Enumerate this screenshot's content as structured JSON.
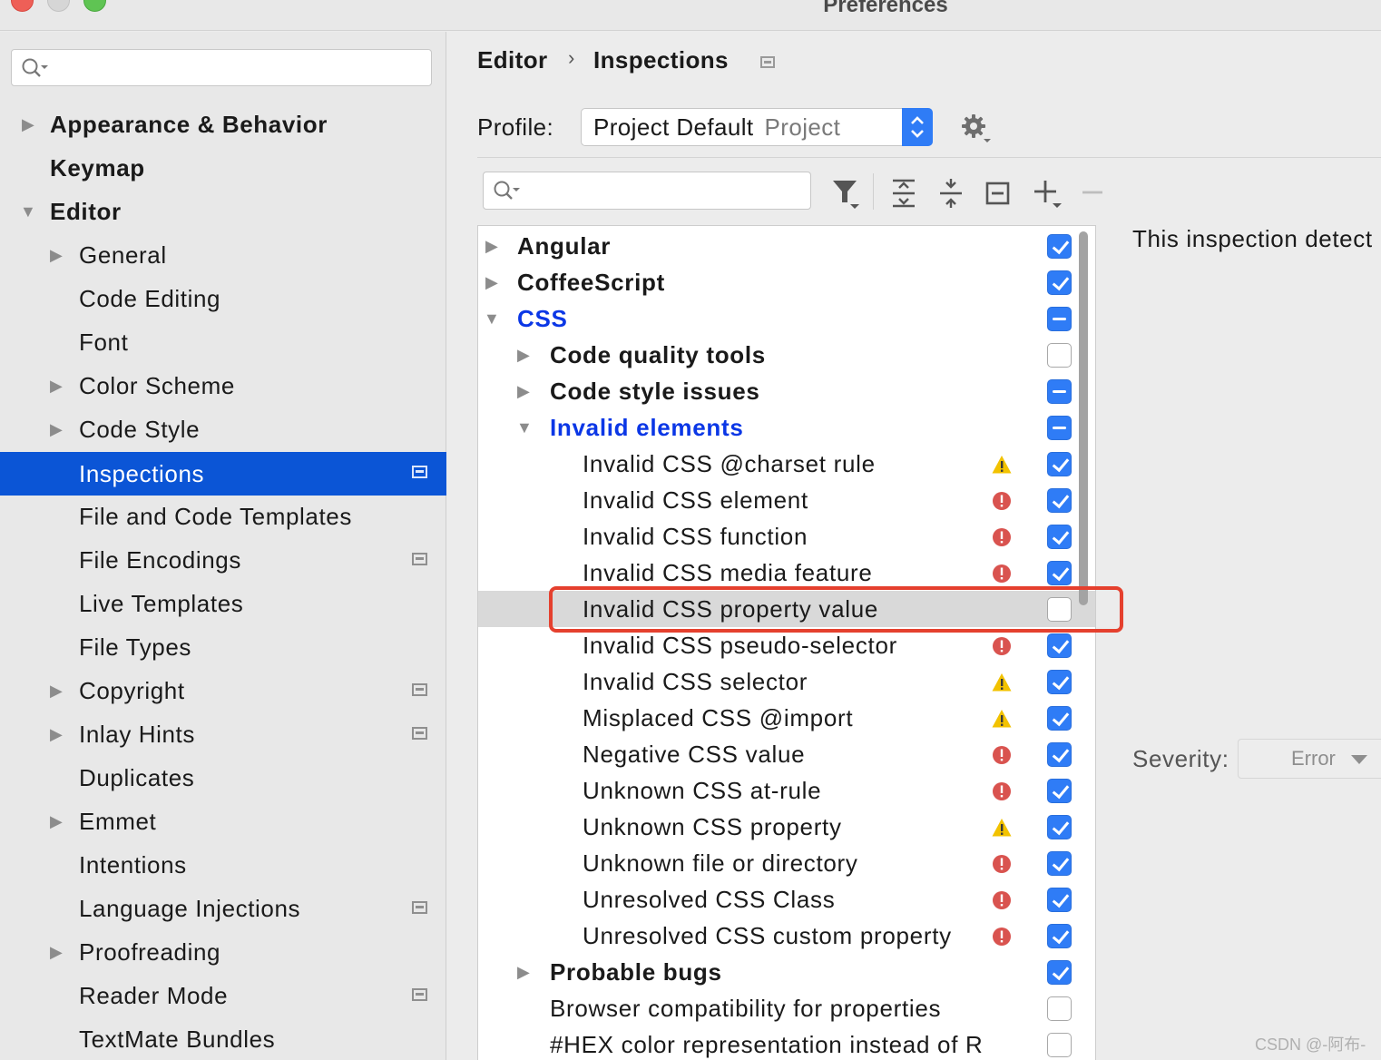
{
  "window": {
    "title": "Preferences"
  },
  "sidebar": {
    "search_placeholder": "",
    "items": [
      {
        "label": "Appearance & Behavior"
      },
      {
        "label": "Keymap"
      },
      {
        "label": "Editor"
      },
      {
        "label": "General"
      },
      {
        "label": "Code Editing"
      },
      {
        "label": "Font"
      },
      {
        "label": "Color Scheme"
      },
      {
        "label": "Code Style"
      },
      {
        "label": "Inspections"
      },
      {
        "label": "File and Code Templates"
      },
      {
        "label": "File Encodings"
      },
      {
        "label": "Live Templates"
      },
      {
        "label": "File Types"
      },
      {
        "label": "Copyright"
      },
      {
        "label": "Inlay Hints"
      },
      {
        "label": "Duplicates"
      },
      {
        "label": "Emmet"
      },
      {
        "label": "Intentions"
      },
      {
        "label": "Language Injections"
      },
      {
        "label": "Proofreading"
      },
      {
        "label": "Reader Mode"
      },
      {
        "label": "TextMate Bundles"
      }
    ]
  },
  "breadcrumb": {
    "parent": "Editor",
    "separator": "›",
    "current": "Inspections"
  },
  "profile": {
    "label": "Profile:",
    "value": "Project Default",
    "scope": "Project"
  },
  "toolbar": {
    "search_placeholder": "",
    "icons": [
      "filter-icon",
      "expand-all-icon",
      "collapse-all-icon",
      "reset-icon",
      "add-icon",
      "remove-icon"
    ]
  },
  "tree": {
    "rows": [
      {
        "label": "Angular",
        "state": "checked"
      },
      {
        "label": "CoffeeScript",
        "state": "checked"
      },
      {
        "label": "CSS",
        "state": "mixed"
      },
      {
        "label": "Code quality tools",
        "state": "unchecked"
      },
      {
        "label": "Code style issues",
        "state": "mixed"
      },
      {
        "label": "Invalid elements",
        "state": "mixed"
      },
      {
        "label": "Invalid CSS @charset rule",
        "severity": "warning",
        "state": "checked"
      },
      {
        "label": "Invalid CSS element",
        "severity": "error",
        "state": "checked"
      },
      {
        "label": "Invalid CSS function",
        "severity": "error",
        "state": "checked"
      },
      {
        "label": "Invalid CSS media feature",
        "severity": "error",
        "state": "checked"
      },
      {
        "label": "Invalid CSS property value",
        "severity": "none",
        "state": "unchecked",
        "selected": true
      },
      {
        "label": "Invalid CSS pseudo-selector",
        "severity": "error",
        "state": "checked"
      },
      {
        "label": "Invalid CSS selector",
        "severity": "warning",
        "state": "checked"
      },
      {
        "label": "Misplaced CSS @import",
        "severity": "warning",
        "state": "checked"
      },
      {
        "label": "Negative CSS value",
        "severity": "error",
        "state": "checked"
      },
      {
        "label": "Unknown CSS at-rule",
        "severity": "error",
        "state": "checked"
      },
      {
        "label": "Unknown CSS property",
        "severity": "warning",
        "state": "checked"
      },
      {
        "label": "Unknown file or directory",
        "severity": "error",
        "state": "checked"
      },
      {
        "label": "Unresolved CSS Class",
        "severity": "error",
        "state": "checked"
      },
      {
        "label": "Unresolved CSS custom property",
        "severity": "error",
        "state": "checked"
      },
      {
        "label": "Probable bugs",
        "state": "checked"
      },
      {
        "label": "Browser compatibility for properties",
        "state": "unchecked"
      },
      {
        "label": "#HEX color representation instead of R",
        "state": "unchecked"
      }
    ]
  },
  "details": {
    "description": "This inspection detect",
    "severity_label": "Severity:",
    "severity_value": "Error"
  },
  "watermark": "CSDN @-阿布-",
  "colors": {
    "accent": "#0b55d6",
    "checkbox": "#2f7cf6",
    "link_blue": "#0b37e6",
    "highlight_box": "#e5402e",
    "error": "#d9534f",
    "warning": "#f2c200"
  }
}
